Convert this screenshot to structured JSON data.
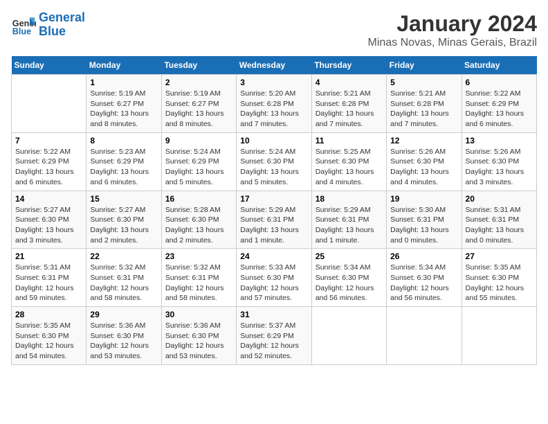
{
  "header": {
    "logo_line1": "General",
    "logo_line2": "Blue",
    "title": "January 2024",
    "subtitle": "Minas Novas, Minas Gerais, Brazil"
  },
  "weekdays": [
    "Sunday",
    "Monday",
    "Tuesday",
    "Wednesday",
    "Thursday",
    "Friday",
    "Saturday"
  ],
  "weeks": [
    [
      {
        "num": "",
        "info": ""
      },
      {
        "num": "1",
        "info": "Sunrise: 5:19 AM\nSunset: 6:27 PM\nDaylight: 13 hours\nand 8 minutes."
      },
      {
        "num": "2",
        "info": "Sunrise: 5:19 AM\nSunset: 6:27 PM\nDaylight: 13 hours\nand 8 minutes."
      },
      {
        "num": "3",
        "info": "Sunrise: 5:20 AM\nSunset: 6:28 PM\nDaylight: 13 hours\nand 7 minutes."
      },
      {
        "num": "4",
        "info": "Sunrise: 5:21 AM\nSunset: 6:28 PM\nDaylight: 13 hours\nand 7 minutes."
      },
      {
        "num": "5",
        "info": "Sunrise: 5:21 AM\nSunset: 6:28 PM\nDaylight: 13 hours\nand 7 minutes."
      },
      {
        "num": "6",
        "info": "Sunrise: 5:22 AM\nSunset: 6:29 PM\nDaylight: 13 hours\nand 6 minutes."
      }
    ],
    [
      {
        "num": "7",
        "info": "Sunrise: 5:22 AM\nSunset: 6:29 PM\nDaylight: 13 hours\nand 6 minutes."
      },
      {
        "num": "8",
        "info": "Sunrise: 5:23 AM\nSunset: 6:29 PM\nDaylight: 13 hours\nand 6 minutes."
      },
      {
        "num": "9",
        "info": "Sunrise: 5:24 AM\nSunset: 6:29 PM\nDaylight: 13 hours\nand 5 minutes."
      },
      {
        "num": "10",
        "info": "Sunrise: 5:24 AM\nSunset: 6:30 PM\nDaylight: 13 hours\nand 5 minutes."
      },
      {
        "num": "11",
        "info": "Sunrise: 5:25 AM\nSunset: 6:30 PM\nDaylight: 13 hours\nand 4 minutes."
      },
      {
        "num": "12",
        "info": "Sunrise: 5:26 AM\nSunset: 6:30 PM\nDaylight: 13 hours\nand 4 minutes."
      },
      {
        "num": "13",
        "info": "Sunrise: 5:26 AM\nSunset: 6:30 PM\nDaylight: 13 hours\nand 3 minutes."
      }
    ],
    [
      {
        "num": "14",
        "info": "Sunrise: 5:27 AM\nSunset: 6:30 PM\nDaylight: 13 hours\nand 3 minutes."
      },
      {
        "num": "15",
        "info": "Sunrise: 5:27 AM\nSunset: 6:30 PM\nDaylight: 13 hours\nand 2 minutes."
      },
      {
        "num": "16",
        "info": "Sunrise: 5:28 AM\nSunset: 6:30 PM\nDaylight: 13 hours\nand 2 minutes."
      },
      {
        "num": "17",
        "info": "Sunrise: 5:29 AM\nSunset: 6:31 PM\nDaylight: 13 hours\nand 1 minute."
      },
      {
        "num": "18",
        "info": "Sunrise: 5:29 AM\nSunset: 6:31 PM\nDaylight: 13 hours\nand 1 minute."
      },
      {
        "num": "19",
        "info": "Sunrise: 5:30 AM\nSunset: 6:31 PM\nDaylight: 13 hours\nand 0 minutes."
      },
      {
        "num": "20",
        "info": "Sunrise: 5:31 AM\nSunset: 6:31 PM\nDaylight: 13 hours\nand 0 minutes."
      }
    ],
    [
      {
        "num": "21",
        "info": "Sunrise: 5:31 AM\nSunset: 6:31 PM\nDaylight: 12 hours\nand 59 minutes."
      },
      {
        "num": "22",
        "info": "Sunrise: 5:32 AM\nSunset: 6:31 PM\nDaylight: 12 hours\nand 58 minutes."
      },
      {
        "num": "23",
        "info": "Sunrise: 5:32 AM\nSunset: 6:31 PM\nDaylight: 12 hours\nand 58 minutes."
      },
      {
        "num": "24",
        "info": "Sunrise: 5:33 AM\nSunset: 6:30 PM\nDaylight: 12 hours\nand 57 minutes."
      },
      {
        "num": "25",
        "info": "Sunrise: 5:34 AM\nSunset: 6:30 PM\nDaylight: 12 hours\nand 56 minutes."
      },
      {
        "num": "26",
        "info": "Sunrise: 5:34 AM\nSunset: 6:30 PM\nDaylight: 12 hours\nand 56 minutes."
      },
      {
        "num": "27",
        "info": "Sunrise: 5:35 AM\nSunset: 6:30 PM\nDaylight: 12 hours\nand 55 minutes."
      }
    ],
    [
      {
        "num": "28",
        "info": "Sunrise: 5:35 AM\nSunset: 6:30 PM\nDaylight: 12 hours\nand 54 minutes."
      },
      {
        "num": "29",
        "info": "Sunrise: 5:36 AM\nSunset: 6:30 PM\nDaylight: 12 hours\nand 53 minutes."
      },
      {
        "num": "30",
        "info": "Sunrise: 5:36 AM\nSunset: 6:30 PM\nDaylight: 12 hours\nand 53 minutes."
      },
      {
        "num": "31",
        "info": "Sunrise: 5:37 AM\nSunset: 6:29 PM\nDaylight: 12 hours\nand 52 minutes."
      },
      {
        "num": "",
        "info": ""
      },
      {
        "num": "",
        "info": ""
      },
      {
        "num": "",
        "info": ""
      }
    ]
  ]
}
